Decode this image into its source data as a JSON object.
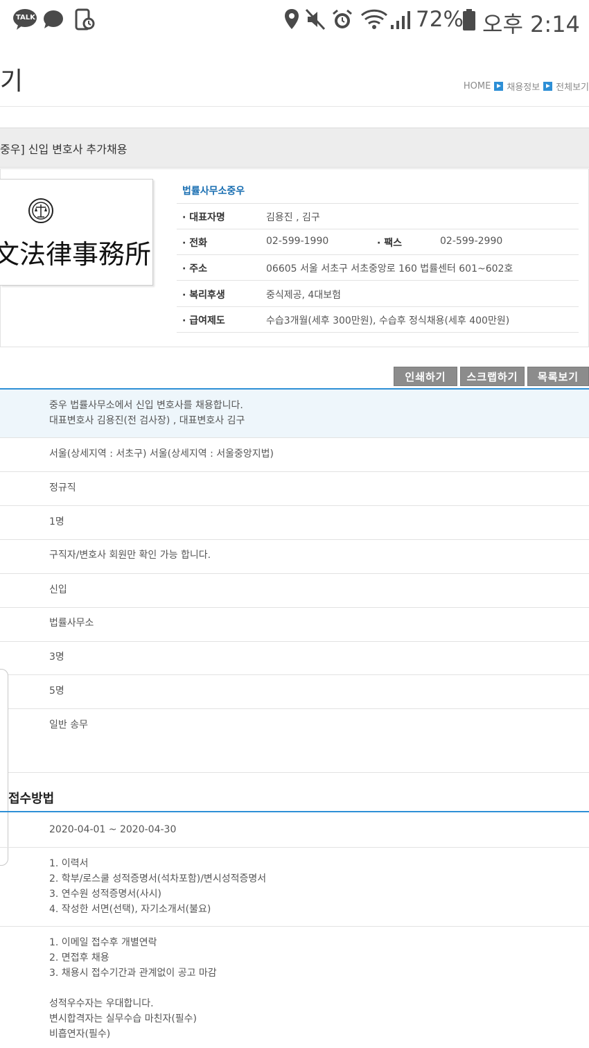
{
  "status_bar": {
    "talk_badge": "TALK",
    "battery_percent": "72%",
    "time": "오후 2:14"
  },
  "header": {
    "page_title": "기",
    "breadcrumb": [
      "HOME",
      "채용정보",
      "전체보기"
    ]
  },
  "job": {
    "title": "중우] 신입 변호사 추가채용"
  },
  "company": {
    "logo_text": "文法律事務所",
    "name": "법률사무소중우",
    "info": [
      {
        "label": "· 대표자명",
        "value": "김용진 , 김구"
      },
      {
        "label": "· 전화",
        "value": "02-599-1990",
        "label2": "· 팩스",
        "value2": "02-599-2990"
      },
      {
        "label": "· 주소",
        "value": "06605 서울 서초구 서초중앙로 160 법률센터 601~602호"
      },
      {
        "label": "· 복리후생",
        "value": "중식제공, 4대보험"
      },
      {
        "label": "· 급여제도",
        "value": "수습3개월(세후 300만원), 수습후 정식채용(세후 400만원)"
      }
    ]
  },
  "toolbar": {
    "print_label": "인쇄하기",
    "scrap_label": "스크랩하기",
    "list_label": "목록보기"
  },
  "details": {
    "intro_line1": "중우 법률사무소에서 신입 변호사를 채용합니다.",
    "intro_line2": "대표변호사 김용진(전 검사장) , 대표변호사 김구",
    "location": "서울(상세지역 : 서초구)   서울(상세지역 : 서울중앙지법)",
    "employment_type": "정규직",
    "headcount": "1명",
    "salary_notice": "구직자/변호사 회원만 확인 가능 합니다.",
    "career": "신입",
    "company_type": "법률사무소",
    "lawyers": "3명",
    "staff": "5명",
    "work": "일반 송무"
  },
  "application": {
    "section_title": "접수방법",
    "period": "2020-04-01 ~ 2020-04-30",
    "documents": [
      "1. 이력서",
      "2. 학부/로스쿨 성적증명서(석차포함)/변시성적증명서",
      "3. 연수원 성적증명서(사시)",
      "4. 작성한 서면(선택), 자기소개서(불요)"
    ],
    "process": [
      "1. 이메일 접수후 개별연락",
      "2. 면접후 채용",
      "3. 채용시 접수기간과 관계없이 공고 마감"
    ],
    "notes": [
      "성적우수자는 우대합니다.",
      "변시합격자는 실무수습 마친자(필수)",
      "비흡연자(필수)"
    ]
  },
  "colors": {
    "accent_blue": "#2d8fd6",
    "company_name_blue": "#1a6fb2",
    "button_gray": "#8c8c8c",
    "highlight_row": "#eef6fb"
  }
}
